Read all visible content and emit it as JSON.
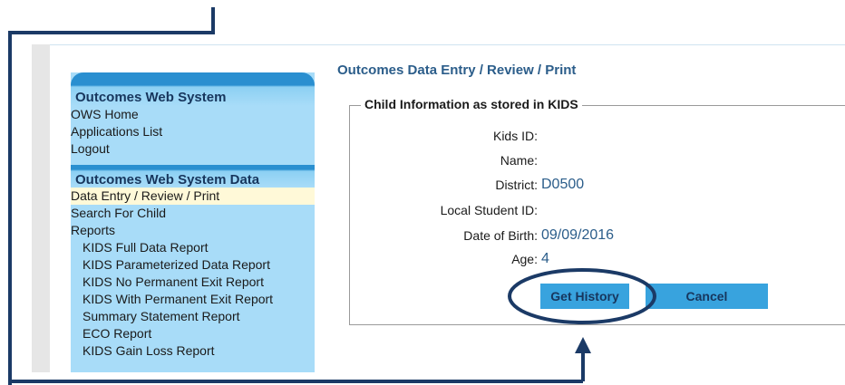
{
  "sidebar": {
    "section1_title": "Outcomes Web System",
    "section1_items": [
      "OWS Home",
      "Applications List",
      "Logout"
    ],
    "section2_title": "Outcomes Web System Data",
    "active_item": "Data Entry / Review / Print",
    "items": [
      "Search For Child",
      "Reports"
    ],
    "report_items": [
      "KIDS Full Data Report",
      "KIDS Parameterized Data Report",
      "KIDS No Permanent Exit Report",
      "KIDS With Permanent Exit Report",
      "Summary Statement Report",
      "ECO Report",
      "KIDS Gain Loss Report"
    ]
  },
  "main": {
    "title": "Outcomes Data Entry / Review / Print",
    "fieldset_legend": "Child Information as stored in KIDS",
    "fields": {
      "kids_id": {
        "label": "Kids ID:",
        "value": ""
      },
      "name": {
        "label": "Name:",
        "value": ""
      },
      "district": {
        "label": "District:",
        "value": "D0500"
      },
      "local_student_id": {
        "label": "Local Student ID:",
        "value": ""
      },
      "dob": {
        "label": "Date of Birth:",
        "value": "09/09/2016"
      },
      "age": {
        "label": "Age:",
        "value": "4"
      }
    },
    "buttons": {
      "get_history": "Get History",
      "cancel": "Cancel"
    }
  },
  "colors": {
    "sidebar_bg": "#a8dcf8",
    "header_blue": "#2a8fd0",
    "button_blue": "#38a3de",
    "annotation_navy": "#1b3a66",
    "value_text": "#2b5d8a"
  }
}
